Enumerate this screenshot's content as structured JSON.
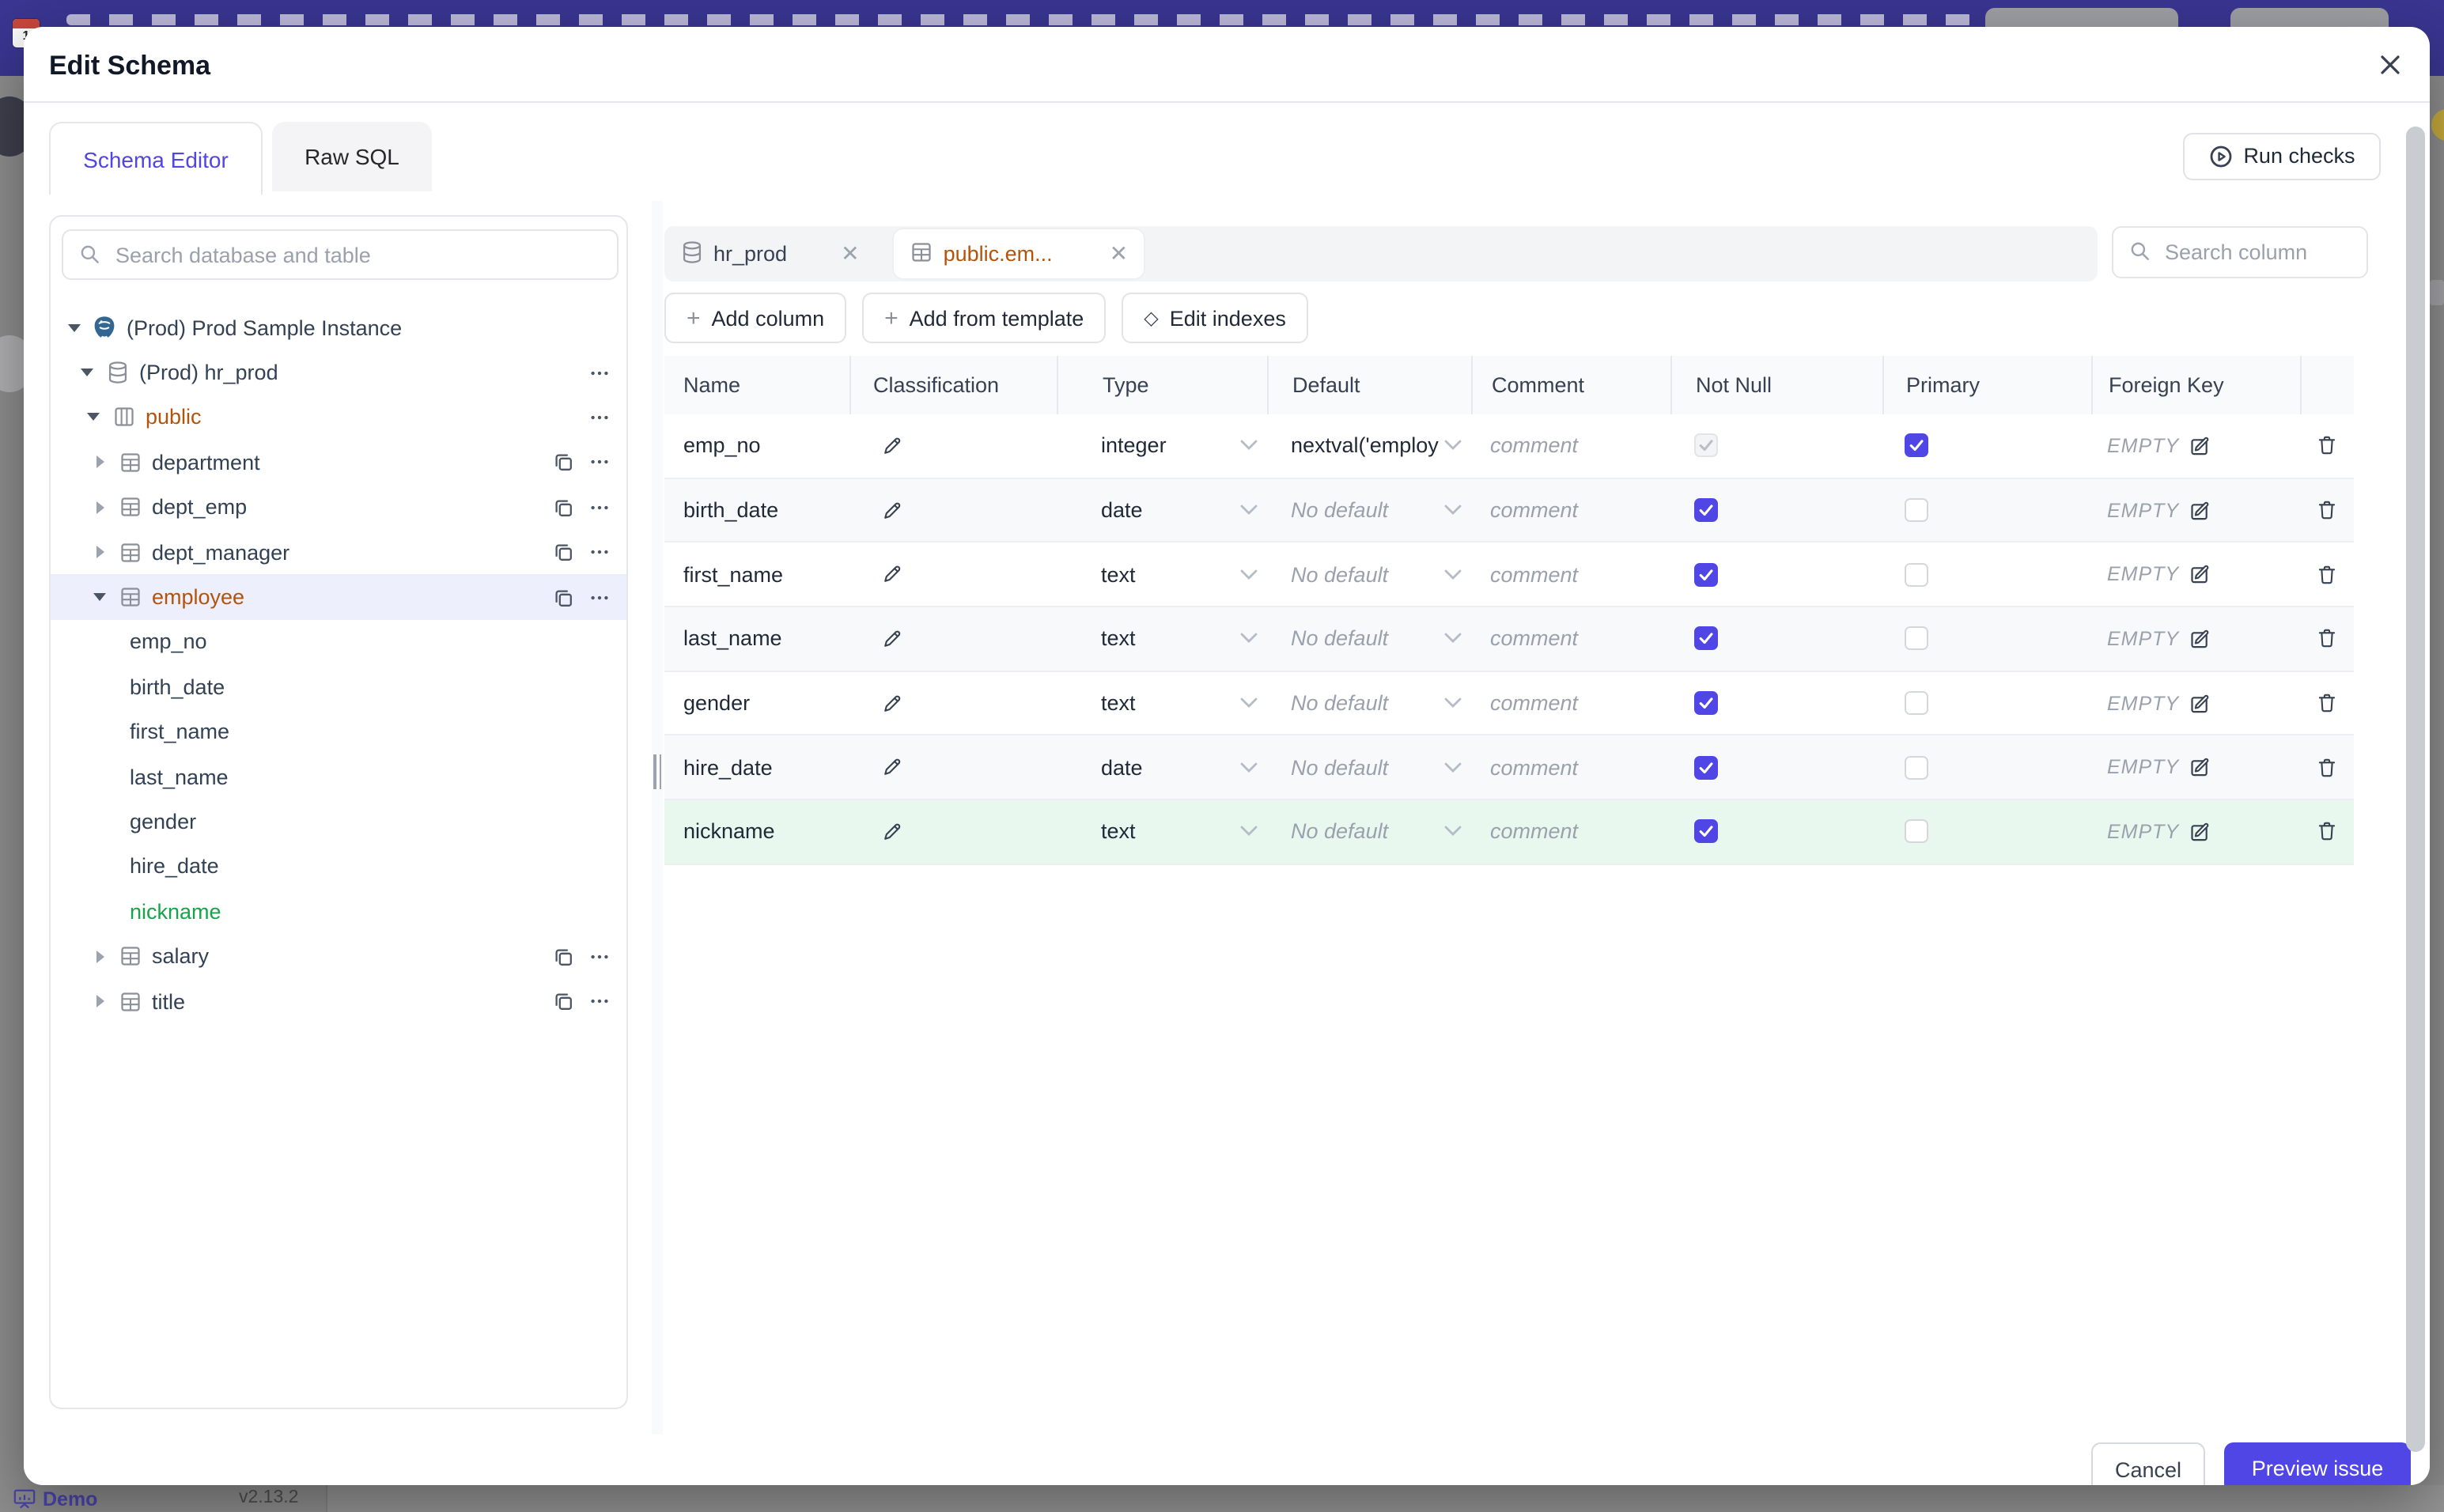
{
  "modal": {
    "title": "Edit Schema",
    "close_icon": "×"
  },
  "tabs": [
    {
      "label": "Schema Editor",
      "active": true
    },
    {
      "label": "Raw SQL",
      "active": false
    }
  ],
  "run_checks": {
    "label": "Run checks"
  },
  "sidebar": {
    "search_placeholder": "Search database and table",
    "tree": [
      {
        "level": 0,
        "kind": "instance",
        "caret": "down",
        "label": "(Prod) Prod Sample Instance"
      },
      {
        "level": 1,
        "kind": "database",
        "caret": "down",
        "label": "(Prod) hr_prod",
        "menu": true
      },
      {
        "level": 2,
        "kind": "schema",
        "caret": "down",
        "label": "public",
        "menu": true,
        "state": "modified"
      },
      {
        "level": 3,
        "kind": "table",
        "caret": "right",
        "label": "department",
        "copy": true,
        "menu": true
      },
      {
        "level": 3,
        "kind": "table",
        "caret": "right",
        "label": "dept_emp",
        "copy": true,
        "menu": true
      },
      {
        "level": 3,
        "kind": "table",
        "caret": "right",
        "label": "dept_manager",
        "copy": true,
        "menu": true
      },
      {
        "level": 3,
        "kind": "table",
        "caret": "down",
        "label": "employee",
        "copy": true,
        "menu": true,
        "state": "modified",
        "selected": true
      },
      {
        "level": 4,
        "kind": "column",
        "label": "emp_no"
      },
      {
        "level": 4,
        "kind": "column",
        "label": "birth_date"
      },
      {
        "level": 4,
        "kind": "column",
        "label": "first_name"
      },
      {
        "level": 4,
        "kind": "column",
        "label": "last_name"
      },
      {
        "level": 4,
        "kind": "column",
        "label": "gender"
      },
      {
        "level": 4,
        "kind": "column",
        "label": "hire_date"
      },
      {
        "level": 4,
        "kind": "column",
        "label": "nickname",
        "state": "added"
      },
      {
        "level": 3,
        "kind": "table",
        "caret": "right",
        "label": "salary",
        "copy": true,
        "menu": true
      },
      {
        "level": 3,
        "kind": "table",
        "caret": "right",
        "label": "title",
        "copy": true,
        "menu": true
      }
    ]
  },
  "editor": {
    "chips": [
      {
        "label": "hr_prod",
        "kind": "database",
        "active": false
      },
      {
        "label": "public.em...",
        "kind": "table",
        "active": true
      }
    ],
    "column_search_placeholder": "Search column",
    "toolbar": [
      {
        "label": "Add column",
        "icon": "plus"
      },
      {
        "label": "Add from template",
        "icon": "plus"
      },
      {
        "label": "Edit indexes",
        "icon": "diamond"
      }
    ],
    "table": {
      "headers": [
        "Name",
        "Classification",
        "Type",
        "Default",
        "Comment",
        "Not Null",
        "Primary",
        "Foreign Key"
      ],
      "comment_placeholder": "comment",
      "no_default_label": "No default",
      "empty_label": "EMPTY",
      "rows": [
        {
          "name": "emp_no",
          "type": "integer",
          "default": "nextval('employ",
          "not_null": "disabled",
          "primary": "checked",
          "zebra": false
        },
        {
          "name": "birth_date",
          "type": "date",
          "default": "",
          "not_null": "checked",
          "primary": "unchecked",
          "zebra": true
        },
        {
          "name": "first_name",
          "type": "text",
          "default": "",
          "not_null": "checked",
          "primary": "unchecked",
          "zebra": false
        },
        {
          "name": "last_name",
          "type": "text",
          "default": "",
          "not_null": "checked",
          "primary": "unchecked",
          "zebra": true
        },
        {
          "name": "gender",
          "type": "text",
          "default": "",
          "not_null": "checked",
          "primary": "unchecked",
          "zebra": false
        },
        {
          "name": "hire_date",
          "type": "date",
          "default": "",
          "not_null": "checked",
          "primary": "unchecked",
          "zebra": true
        },
        {
          "name": "nickname",
          "type": "text",
          "default": "",
          "not_null": "checked",
          "primary": "unchecked",
          "added": true
        }
      ]
    }
  },
  "footer": {
    "cancel_label": "Cancel",
    "primary_label": "Preview issue"
  },
  "underlying": {
    "demo_label": "Demo",
    "version": "v2.13.2",
    "calendar_day": "1"
  },
  "colors": {
    "accent": "#4f46e5",
    "modified": "#b45309",
    "added": "#16a34a",
    "added_row_bg": "#e9f8ef",
    "selected_row_bg": "#edeffd",
    "banner": "#3a3692",
    "postgres_blue": "#336791"
  }
}
